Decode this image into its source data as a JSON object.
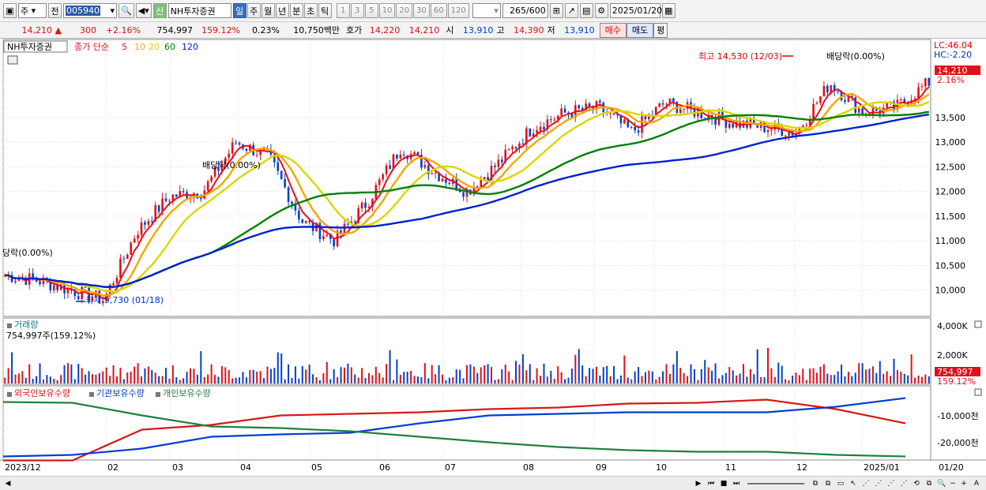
{
  "toolbar": {
    "market": "주",
    "prev": "전",
    "code": "005940",
    "name": "NH투자증권",
    "credit_badge": "신",
    "periods": [
      "일",
      "주",
      "월",
      "년",
      "분",
      "초",
      "틱"
    ],
    "active_period": "일",
    "minute_steps": [
      "1",
      "3",
      "5",
      "10",
      "20",
      "30",
      "60",
      "120"
    ],
    "count": "265",
    "count_max": "/600",
    "date": "2025/01/20"
  },
  "price": {
    "current": "14,210",
    "arrow": "▲",
    "change": "300",
    "change_pct": "+2.16%",
    "volume": "754,997",
    "vol_ratio": "159.12%",
    "turnover": "0.23%",
    "value": "10,750백만",
    "ask_label": "호가",
    "ask": "14,220",
    "bid": "14,210",
    "open_label": "시",
    "open": "13,910",
    "high_label": "고",
    "high": "14,390",
    "low_label": "저",
    "low": "13,910",
    "buy": "매수",
    "sell": "매도",
    "eval": "평"
  },
  "main": {
    "title": "NH투자증권",
    "legend_prefix": "종가 단순",
    "ma_labels": [
      "5",
      "10",
      "20",
      "60",
      "120"
    ],
    "ma_colors": [
      "#e8101a",
      "#f5a700",
      "#d8d800",
      "#008000",
      "#0020d0"
    ],
    "lc": "LC:46.04",
    "hc": "HC:-2.20",
    "price_tag": "14,210",
    "pct_tag": "2.16%",
    "annotation_high": "최고 14,530 (12/03)",
    "annotation_low": "최저 9,730 (01/18)",
    "div_left": "당락(0.00%)",
    "div_mid": "배당락(0.00%)",
    "div_right": "배당락(0.00%)"
  },
  "volume": {
    "title": "거래량",
    "value_line": "754,997주(159.12%)",
    "axis": [
      "4,000K",
      "2,000K"
    ],
    "tag_value": "754,997",
    "tag_pct": "159.12%"
  },
  "holdings": {
    "legend": [
      "외국인보유수량",
      "기관보유수량",
      "개인보유수량"
    ],
    "colors": [
      "#d81818",
      "#0040d0",
      "#208040"
    ],
    "axis": [
      "-10,000천",
      "-20,000천"
    ]
  },
  "xaxis": {
    "labels": [
      "2023/12",
      "02",
      "03",
      "04",
      "05",
      "06",
      "07",
      "08",
      "09",
      "10",
      "11",
      "12",
      "2025/01",
      "01/20"
    ]
  },
  "chart_data": {
    "type": "line",
    "title": "NH투자증권",
    "ylim": [
      9500,
      15000
    ],
    "yticks": [
      10000,
      10500,
      11000,
      11500,
      12000,
      12500,
      13000,
      13500
    ],
    "x": [
      "2023/12",
      "02",
      "03",
      "04",
      "05",
      "06",
      "07",
      "08",
      "09",
      "10",
      "11",
      "12",
      "2025/01",
      "01/20"
    ],
    "close": [
      10300,
      10200,
      10000,
      9800,
      11200,
      11900,
      12000,
      13000,
      12700,
      11400,
      11000,
      11800,
      12900,
      12400,
      12000,
      12600,
      13300,
      13600,
      13700,
      13200,
      13800,
      13600,
      13400,
      13300,
      13200,
      14200,
      13600,
      13700,
      14210
    ],
    "series": [
      {
        "name": "5",
        "values": [
          10300,
          10200,
          10000,
          9800,
          11200,
          11900,
          12000,
          13000,
          12700,
          11400,
          11000,
          11800,
          12900,
          12400,
          12000,
          12600,
          13300,
          13600,
          13700,
          13200,
          13800,
          13600,
          13400,
          13300,
          13200,
          14200,
          13600,
          13700,
          14210
        ]
      },
      {
        "name": "120",
        "values": [
          10200,
          10250,
          10300,
          10400,
          10500,
          10700,
          10900,
          11200,
          11400,
          11600,
          11800,
          12000,
          12200,
          12500,
          12800,
          13000,
          13200,
          13400,
          13500,
          13600,
          13700,
          13700
        ]
      }
    ]
  }
}
